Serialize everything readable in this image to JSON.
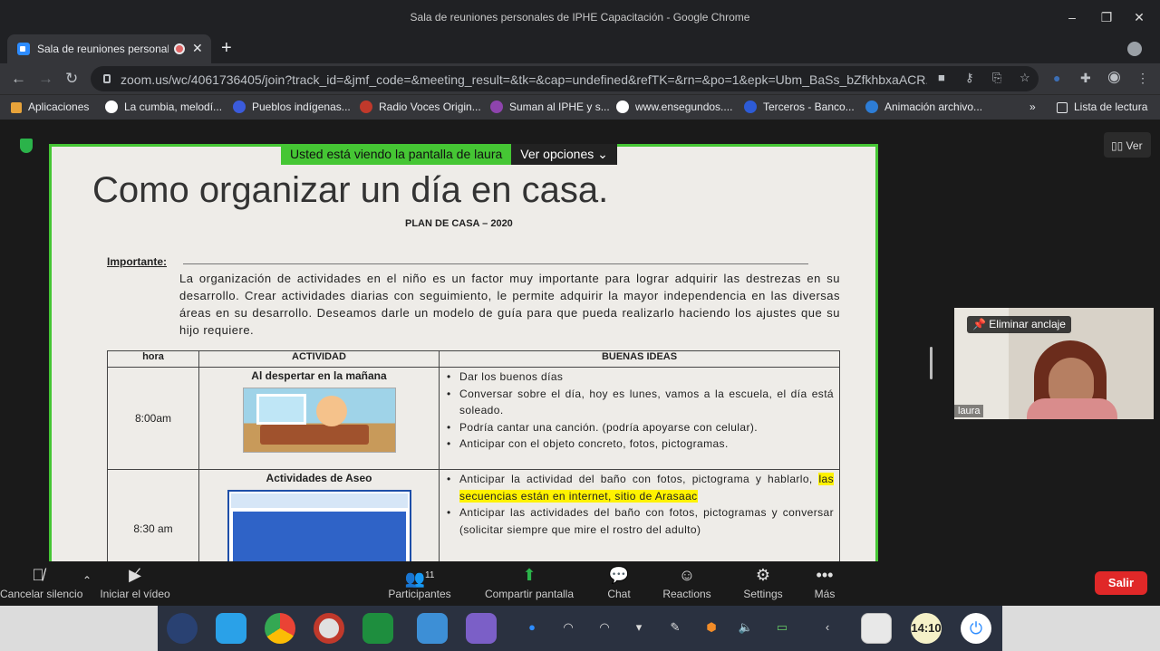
{
  "window": {
    "title": "Sala de reuniones personales de IPHE Capacitación - Google Chrome",
    "minimize": "–",
    "maximize": "❐",
    "close": "✕"
  },
  "tab": {
    "label": "Sala de reuniones personales",
    "close": "✕",
    "new_tab": "+"
  },
  "address": {
    "url": "zoom.us/wc/4061736405/join?track_id=&jmf_code=&meeting_result=&tk=&cap=undefined&refTK=&rn=&po=1&epk=Ubm_BaSs_bZfkhbxaACR...",
    "back": "←",
    "forward": "→",
    "reload": "↻"
  },
  "bookmarks": [
    {
      "label": "Aplicaciones",
      "color": "#e8a33a"
    },
    {
      "label": "La cumbia, melodí...",
      "color": "#ffffff"
    },
    {
      "label": "Pueblos indígenas...",
      "color": "#3b5bdb"
    },
    {
      "label": "Radio Voces Origin...",
      "color": "#c0392b"
    },
    {
      "label": "Suman al IPHE y s...",
      "color": "#8e44ad"
    },
    {
      "label": "www.ensegundos....",
      "color": "#ffffff"
    },
    {
      "label": "Terceros - Banco...",
      "color": "#2d5bd6"
    },
    {
      "label": "Animación archivo...",
      "color": "#2d7dd6"
    }
  ],
  "reading_list": "Lista de lectura",
  "overflow": "»",
  "banner": {
    "viewing": "Usted está viendo la pantalla de laura",
    "options": "Ver opciones"
  },
  "view_button": "Ver",
  "document": {
    "title": "Como organizar un día en casa.",
    "subtitle": "PLAN DE CASA – 2020",
    "important_label": "Importante:",
    "paragraph": "La organización de actividades en el niño es un factor muy importante para lograr adquirir las destrezas en su desarrollo. Crear actividades diarias con seguimiento, le permite adquirir la mayor independencia en las diversas áreas en su desarrollo. Deseamos darle un modelo de guía para que pueda realizarlo haciendo los ajustes que su hijo requiere.",
    "table": {
      "headers": [
        "hora",
        "ACTIVIDAD",
        "BUENAS IDEAS"
      ],
      "rows": [
        {
          "hora": "8:00am",
          "actividad": "Al despertar en la mañana",
          "ideas": [
            "Dar los buenos días",
            "Conversar sobre el día, hoy es lunes, vamos a la escuela, el día está soleado.",
            "Podría cantar una canción. (podría apoyarse con celular).",
            "Anticipar con el objeto concreto, fotos, pictogramas."
          ]
        },
        {
          "hora": "8:30 am",
          "actividad": "Actividades de Aseo",
          "idea1_plain": "Anticipar la actividad del baño con fotos, pictograma y hablarlo,",
          "idea1_highlight": "las secuencias están en internet, sitio de Arasaac",
          "idea2": "Anticipar las actividades del baño con fotos, pictogramas y conversar (solicitar siempre que mire el rostro del adulto)"
        }
      ]
    }
  },
  "participant": {
    "name": "laura",
    "unpin": "Eliminar anclaje"
  },
  "toolbar": {
    "mute": "Cancelar silencio",
    "video": "Iniciar el vídeo",
    "participants": "Participantes",
    "participants_count": "11",
    "share": "Compartir pantalla",
    "chat": "Chat",
    "reactions": "Reactions",
    "settings": "Settings",
    "more": "Más",
    "leave": "Salir"
  },
  "clock": "14:10"
}
